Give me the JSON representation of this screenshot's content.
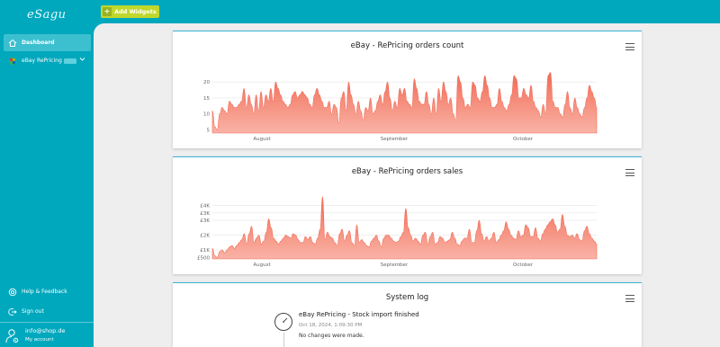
{
  "brand": {
    "logo_text": "eSagu"
  },
  "sidebar": {
    "items": [
      {
        "label": "Dashboard",
        "icon": "home-icon",
        "active": true
      },
      {
        "label": "eBay RePricing",
        "icon": "ebay-icon",
        "active": false
      }
    ],
    "bottom": [
      {
        "label": "Help & Feedback",
        "icon": "help-icon"
      },
      {
        "label": "Sign out",
        "icon": "signout-icon"
      }
    ],
    "account": {
      "email": "info@shop.de",
      "label": "My account"
    }
  },
  "toolbar": {
    "add_widgets_label": "Add Widgets",
    "accent": "#c0d82c"
  },
  "colors": {
    "sidebar": "#00a8bd",
    "area_fill": "#f47e6c",
    "card_border": "#3bb6d3"
  },
  "chart_data": [
    {
      "type": "area",
      "title": "eBay - RePricing orders count",
      "ylim": [
        4,
        24
      ],
      "yticks": [
        "5",
        "10",
        "15",
        "20"
      ],
      "x_labels": [
        "August",
        "September",
        "October"
      ],
      "values": [
        11,
        6,
        5,
        10,
        12,
        11,
        10,
        14,
        13,
        12,
        12,
        13,
        14,
        18,
        12,
        16,
        13,
        10,
        16,
        11,
        17,
        12,
        16,
        14,
        18,
        14,
        20,
        18,
        16,
        14,
        13,
        12,
        13,
        16,
        17,
        15,
        16,
        17,
        16,
        15,
        13,
        12,
        16,
        18,
        16,
        14,
        12,
        12,
        14,
        10,
        13,
        12,
        7,
        15,
        17,
        11,
        20,
        16,
        13,
        10,
        14,
        11,
        8,
        12,
        11,
        15,
        10,
        11,
        14,
        16,
        13,
        17,
        20,
        15,
        11,
        14,
        12,
        18,
        16,
        18,
        14,
        13,
        12,
        21,
        18,
        14,
        13,
        13,
        17,
        13,
        10,
        15,
        10,
        18,
        14,
        20,
        17,
        13,
        15,
        10,
        8,
        22,
        20,
        15,
        12,
        13,
        12,
        20,
        19,
        15,
        14,
        17,
        22,
        19,
        15,
        12,
        12,
        13,
        18,
        14,
        12,
        11,
        13,
        16,
        22,
        21,
        15,
        15,
        18,
        16,
        15,
        19,
        14,
        12,
        11,
        9,
        13,
        10,
        22,
        23,
        14,
        12,
        12,
        10,
        9,
        13,
        17,
        12,
        10,
        15,
        12,
        10,
        9,
        12,
        15,
        19,
        17,
        15,
        12
      ]
    },
    {
      "type": "area",
      "title": "eBay - RePricing orders sales",
      "ylim": [
        400,
        4700
      ],
      "yticks": [
        "£500",
        "£1K",
        "£2K",
        "£3K",
        "£3K",
        "£4K"
      ],
      "x_labels": [
        "August",
        "September",
        "October"
      ],
      "values": [
        1100,
        600,
        500,
        900,
        1000,
        800,
        1000,
        1200,
        1300,
        1100,
        1300,
        1500,
        1700,
        2100,
        1400,
        2100,
        2600,
        1500,
        1800,
        2000,
        1400,
        1600,
        2200,
        3100,
        2500,
        1800,
        1600,
        1400,
        1600,
        1800,
        2000,
        1900,
        1800,
        2100,
        2000,
        1700,
        1500,
        1500,
        1900,
        1700,
        1900,
        1500,
        1400,
        1800,
        2400,
        4600,
        1700,
        2200,
        1900,
        1800,
        1500,
        1300,
        2100,
        2400,
        1600,
        2000,
        2300,
        1500,
        1300,
        2700,
        1500,
        1700,
        1500,
        1300,
        1200,
        1600,
        1800,
        2000,
        1600,
        1200,
        1800,
        2000,
        2000,
        1800,
        1600,
        1500,
        1600,
        1900,
        2200,
        3800,
        2500,
        2000,
        1600,
        1800,
        1600,
        1400,
        2000,
        2200,
        1400,
        1900,
        2200,
        1400,
        1500,
        1900,
        1800,
        1500,
        1600,
        1700,
        2200,
        1800,
        1400,
        1300,
        1600,
        1800,
        1800,
        2400,
        1500,
        1500,
        2300,
        3000,
        2100,
        1600,
        1900,
        1600,
        1800,
        2200,
        1500,
        1700,
        2000,
        2300,
        2900,
        2400,
        2000,
        1800,
        1700,
        2300,
        1900,
        2000,
        2700,
        2500,
        1900,
        1900,
        2500,
        1800,
        1600,
        2100,
        2400,
        2700,
        2900,
        3100,
        2700,
        2200,
        2400,
        3400,
        2600,
        2000,
        1900,
        2000,
        1800,
        2100,
        1700,
        1600,
        2300,
        2600,
        2100,
        1800,
        1600,
        1400
      ]
    }
  ],
  "system_log": {
    "title": "System log",
    "entries": [
      {
        "title": "eBay RePricing - Stock import finished",
        "date": "Oct 18, 2024, 1:09:30 PM",
        "message": "No changes were made."
      }
    ]
  }
}
